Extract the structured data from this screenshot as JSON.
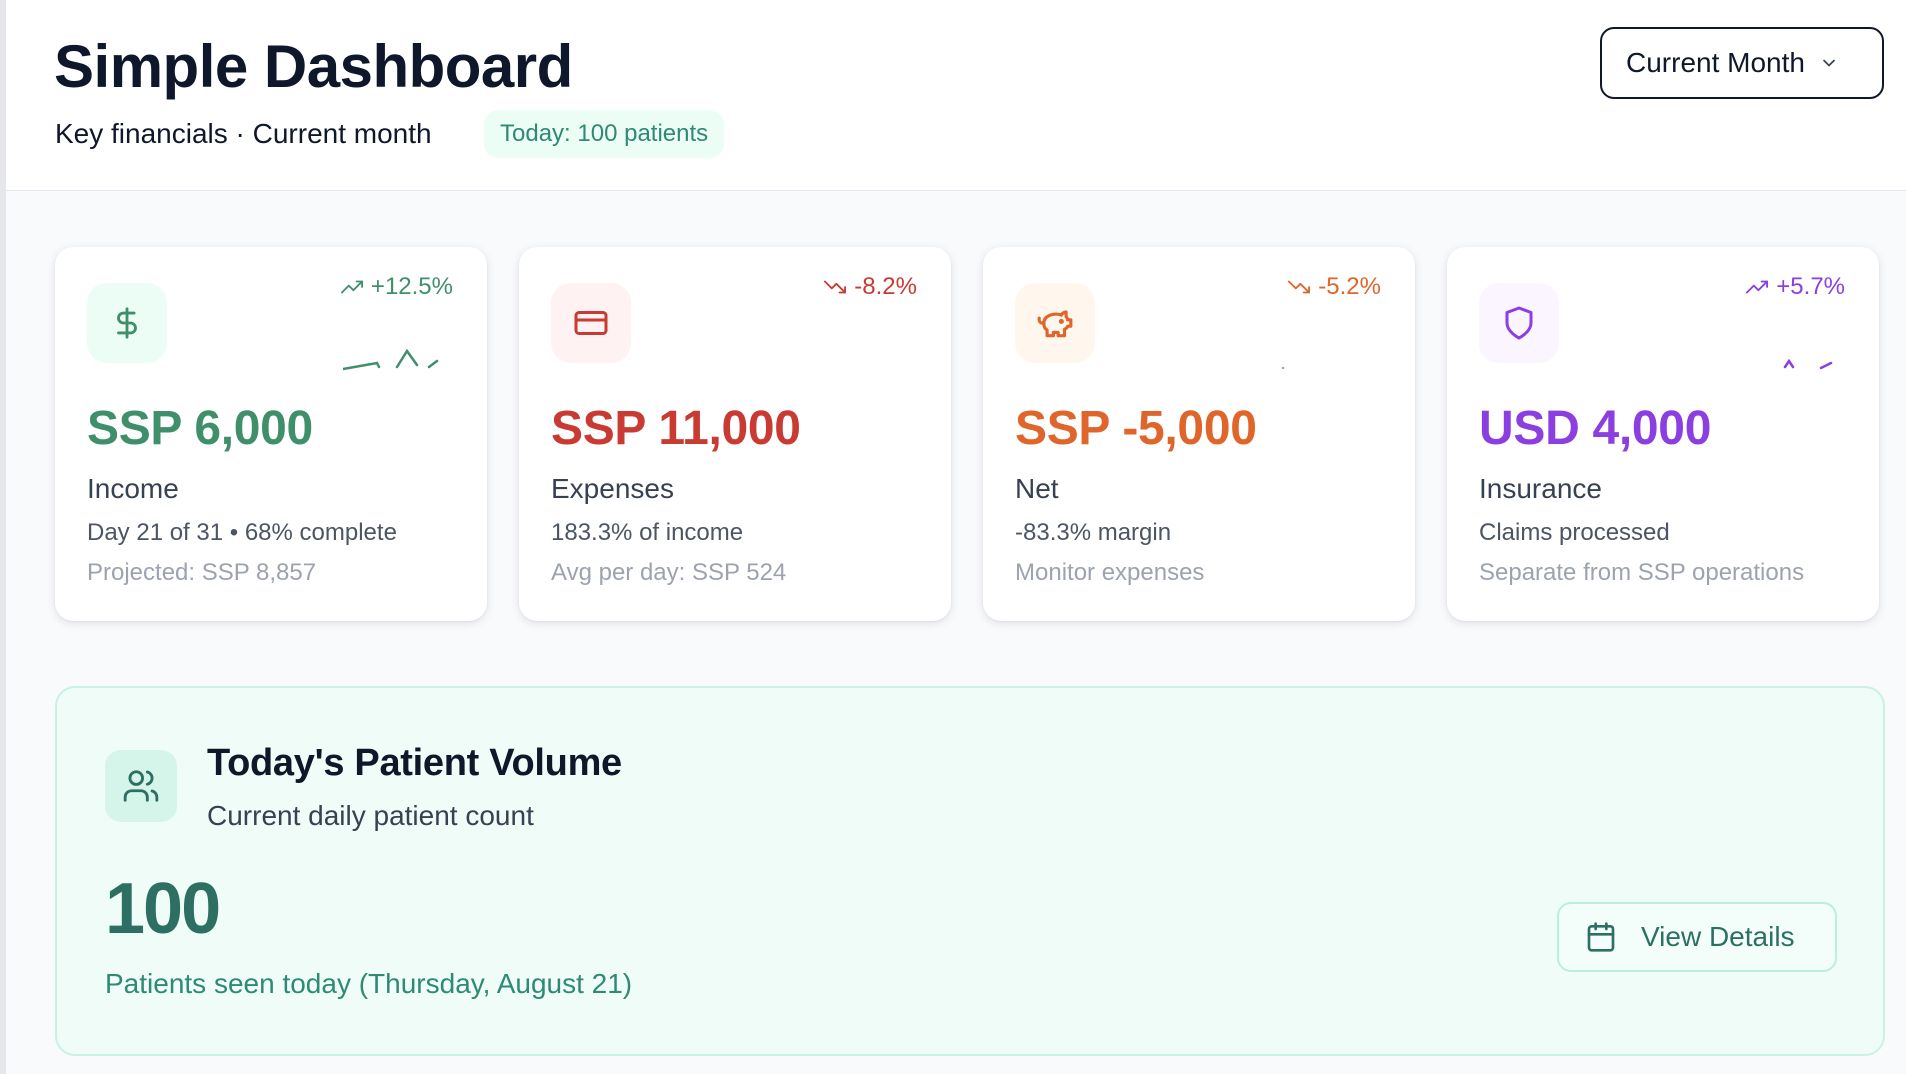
{
  "header": {
    "title": "Simple Dashboard",
    "subtitle": "Key financials · Current month",
    "today_pill": "Today: 100 patients",
    "period_select": {
      "selected": "Current Month",
      "icon": "chevron-down-icon"
    }
  },
  "cards": [
    {
      "id": "income",
      "icon": "dollar-icon",
      "delta": "+12.5%",
      "delta_direction": "up",
      "amount": "SSP 6,000",
      "label": "Income",
      "line1": "Day 21 of 31 • 68% complete",
      "line2": "Projected: SSP 8,857",
      "accent": "#3f8f6b",
      "icon_bg": "#ecfdf5"
    },
    {
      "id": "expenses",
      "icon": "credit-card-icon",
      "delta": "-8.2%",
      "delta_direction": "down",
      "amount": "SSP 11,000",
      "label": "Expenses",
      "line1": "183.3% of income",
      "line2": "Avg per day: SSP 524",
      "accent": "#c93a33",
      "icon_bg": "#fef2f2"
    },
    {
      "id": "net",
      "icon": "piggy-bank-icon",
      "delta": "-5.2%",
      "delta_direction": "down",
      "amount": "SSP -5,000",
      "label": "Net",
      "line1": "-83.3% margin",
      "line2": "Monitor expenses",
      "accent": "#e0652a",
      "icon_bg": "#fff7ed"
    },
    {
      "id": "insurance",
      "icon": "shield-icon",
      "delta": "+5.7%",
      "delta_direction": "up",
      "amount": "USD 4,000",
      "label": "Insurance",
      "line1": "Claims processed",
      "line2": "Separate from SSP operations",
      "accent": "#8b3fe0",
      "icon_bg": "#faf5ff"
    }
  ],
  "patient_volume": {
    "icon": "users-icon",
    "title": "Today's Patient Volume",
    "subtitle": "Current daily patient count",
    "count": "100",
    "caption": "Patients seen today (Thursday, August 21)",
    "button_label": "View Details",
    "button_icon": "calendar-icon"
  }
}
